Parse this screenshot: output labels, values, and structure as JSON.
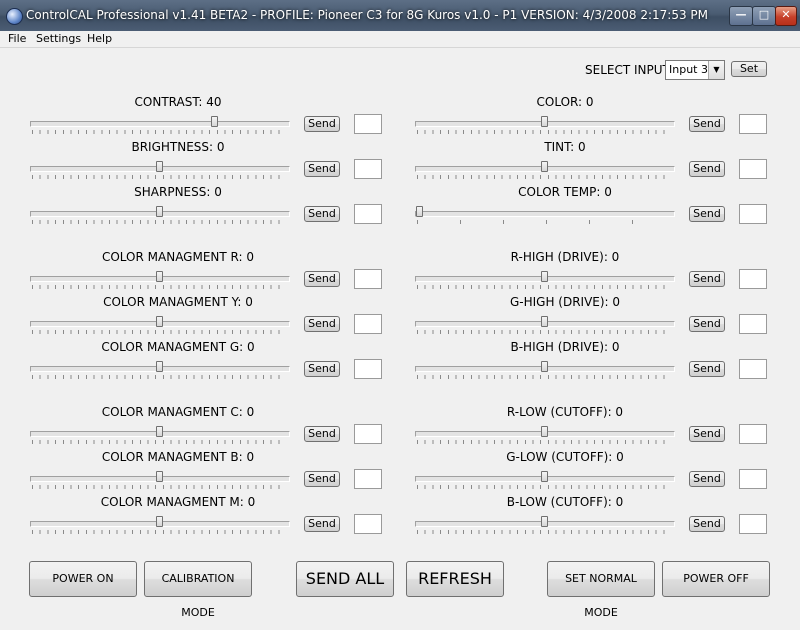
{
  "window": {
    "title": "ControlCAL Professional v1.41 BETA2 - PROFILE: Pioneer C3 for 8G Kuros v1.0 - P1  VERSION: 4/3/2008 2:17:53 PM",
    "minimize_glyph": "—",
    "maximize_glyph": "□",
    "close_glyph": "✕"
  },
  "menu": [
    "File",
    "Settings",
    "Help"
  ],
  "input": {
    "label": "SELECT INPUT",
    "value": "Input 3",
    "set_label": "Set"
  },
  "send_label": "Send",
  "controls_left": [
    {
      "label": "CONTRAST: 40",
      "value": 40
    },
    {
      "label": "BRIGHTNESS: 0",
      "value": 0
    },
    {
      "label": "SHARPNESS: 0",
      "value": 0
    },
    {
      "label": "COLOR MANAGMENT R: 0",
      "value": 0
    },
    {
      "label": "COLOR MANAGMENT Y: 0",
      "value": 0
    },
    {
      "label": "COLOR MANAGMENT G: 0",
      "value": 0
    },
    {
      "label": "COLOR MANAGMENT C: 0",
      "value": 0
    },
    {
      "label": "COLOR MANAGMENT B: 0",
      "value": 0
    },
    {
      "label": "COLOR MANAGMENT M: 0",
      "value": 0
    }
  ],
  "controls_right": [
    {
      "label": "COLOR: 0",
      "value": 0
    },
    {
      "label": "TINT: 0",
      "value": 0
    },
    {
      "label": "COLOR TEMP: 0",
      "value": 0
    },
    {
      "label": "R-HIGH (DRIVE): 0",
      "value": 0
    },
    {
      "label": "G-HIGH (DRIVE): 0",
      "value": 0
    },
    {
      "label": "B-HIGH (DRIVE): 0",
      "value": 0
    },
    {
      "label": "R-LOW (CUTOFF): 0",
      "value": 0
    },
    {
      "label": "G-LOW (CUTOFF): 0",
      "value": 0
    },
    {
      "label": "B-LOW (CUTOFF): 0",
      "value": 0
    }
  ],
  "buttons": {
    "power_on": "POWER ON",
    "calibration_mode": "CALIBRATION MODE",
    "send_all": "SEND ALL",
    "refresh": "REFRESH",
    "set_normal_mode": "SET NORMAL MODE",
    "power_off": "POWER OFF"
  }
}
